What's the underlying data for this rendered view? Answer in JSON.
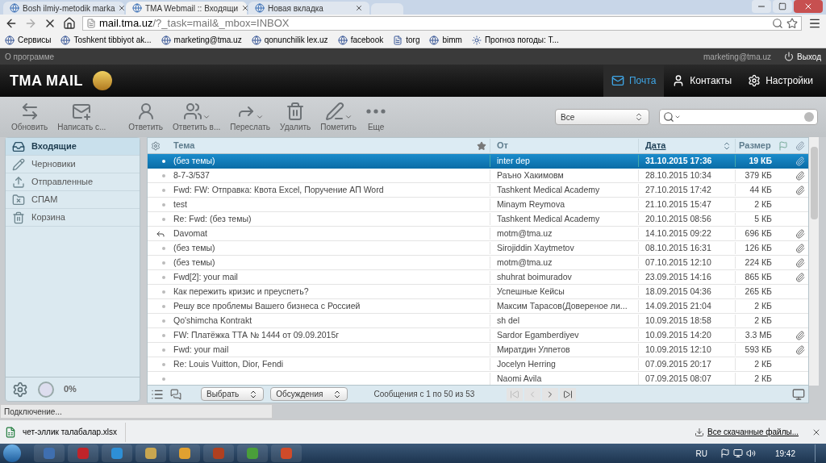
{
  "browser": {
    "tabs": [
      {
        "title": "Bosh ilmiy-metodik marka",
        "selected": false
      },
      {
        "title": "TMA Webmail :: Входящи",
        "selected": true
      },
      {
        "title": "Новая вкладка",
        "selected": false
      }
    ],
    "address": {
      "host": "mail.tma.uz",
      "path": "/?_task=mail&_mbox=INBOX"
    },
    "bookmarks": [
      "Сервисы",
      "Toshkent tibbiyot ak...",
      "marketing@tma.uz",
      "qonunchilik lex.uz",
      "facebook",
      "torg",
      "bimm",
      "Прогноз погоды: Т..."
    ]
  },
  "topbar": {
    "about": "О программе",
    "user": "marketing@tma.uz",
    "logout": "Выход"
  },
  "header": {
    "logo": "TMA MAIL",
    "nav": [
      {
        "label": "Почта",
        "selected": true
      },
      {
        "label": "Контакты",
        "selected": false
      },
      {
        "label": "Настройки",
        "selected": false
      }
    ]
  },
  "toolbar": {
    "buttons": [
      {
        "label": "Обновить",
        "dropdown": false
      },
      {
        "label": "Написать с...",
        "dropdown": false
      },
      {
        "label": "Ответить",
        "dropdown": false
      },
      {
        "label": "Ответить в...",
        "dropdown": true
      },
      {
        "label": "Переслать",
        "dropdown": true
      },
      {
        "label": "Удалить",
        "dropdown": false
      },
      {
        "label": "Пометить",
        "dropdown": true
      },
      {
        "label": "Еще",
        "dropdown": false
      }
    ],
    "filter": "Все"
  },
  "folders": [
    {
      "name": "Входящие",
      "selected": true
    },
    {
      "name": "Черновики",
      "selected": false
    },
    {
      "name": "Отправленные",
      "selected": false
    },
    {
      "name": "СПАМ",
      "selected": false
    },
    {
      "name": "Корзина",
      "selected": false
    }
  ],
  "quota": "0%",
  "table": {
    "columns": [
      "Тема",
      "От",
      "Дата",
      "Размер"
    ],
    "rows": [
      {
        "subject": "(без темы)",
        "from": "inter dep",
        "date": "31.10.2015 17:36",
        "size": "19 КБ",
        "attachment": true,
        "replied": false,
        "selected": true
      },
      {
        "subject": "8-7-3/537",
        "from": "Раъно Хакимовм",
        "date": "28.10.2015 10:34",
        "size": "379 КБ",
        "attachment": true,
        "replied": false,
        "selected": false
      },
      {
        "subject": "Fwd: FW: Отправка: Квота Excel, Поручение АП Word",
        "from": "Tashkent Medical Academy",
        "date": "27.10.2015 17:42",
        "size": "44 КБ",
        "attachment": true,
        "replied": false,
        "selected": false
      },
      {
        "subject": "test",
        "from": "Minaym Reymova",
        "date": "21.10.2015 15:47",
        "size": "2 КБ",
        "attachment": false,
        "replied": false,
        "selected": false
      },
      {
        "subject": "Re: Fwd: (без темы)",
        "from": "Tashkent Medical Academy",
        "date": "20.10.2015 08:56",
        "size": "5 КБ",
        "attachment": false,
        "replied": false,
        "selected": false
      },
      {
        "subject": "Davomat",
        "from": "motm@tma.uz",
        "date": "14.10.2015 09:22",
        "size": "696 КБ",
        "attachment": true,
        "replied": true,
        "selected": false
      },
      {
        "subject": "(без темы)",
        "from": "Sirojiddin Xaytmetov",
        "date": "08.10.2015 16:31",
        "size": "126 КБ",
        "attachment": true,
        "replied": false,
        "selected": false
      },
      {
        "subject": "(без темы)",
        "from": "motm@tma.uz",
        "date": "07.10.2015 12:10",
        "size": "224 КБ",
        "attachment": true,
        "replied": false,
        "selected": false
      },
      {
        "subject": "Fwd[2]: your mail",
        "from": "shuhrat boimuradov",
        "date": "23.09.2015 14:16",
        "size": "865 КБ",
        "attachment": true,
        "replied": false,
        "selected": false
      },
      {
        "subject": "Как пережить кризис и преуспеть?",
        "from": "Успешные Кейсы",
        "date": "18.09.2015 04:36",
        "size": "265 КБ",
        "attachment": false,
        "replied": false,
        "selected": false
      },
      {
        "subject": "Решу все проблемы Вашего бизнеса с Россией",
        "from": "Максим Тарасов(Довереное ли...",
        "date": "14.09.2015 21:04",
        "size": "2 КБ",
        "attachment": false,
        "replied": false,
        "selected": false
      },
      {
        "subject": "Qo'shimcha Kontrakt",
        "from": "sh del",
        "date": "10.09.2015 18:58",
        "size": "2 КБ",
        "attachment": false,
        "replied": false,
        "selected": false
      },
      {
        "subject": "FW: Платёжка ТТА № 1444 от 09.09.2015г",
        "from": "Sardor Egamberdiyev",
        "date": "10.09.2015 14:20",
        "size": "3.3 МБ",
        "attachment": true,
        "replied": false,
        "selected": false
      },
      {
        "subject": "Fwd: your mail",
        "from": "Миратдин Улпетов",
        "date": "10.09.2015 12:10",
        "size": "593 КБ",
        "attachment": true,
        "replied": false,
        "selected": false
      },
      {
        "subject": "Re: Louis Vuitton, Dior, Fendi",
        "from": "Jocelyn Herring",
        "date": "07.09.2015 20:17",
        "size": "2 КБ",
        "attachment": false,
        "replied": false,
        "selected": false
      },
      {
        "subject": "",
        "from": "Naomi Avila",
        "date": "07.09.2015 08:07",
        "size": "2 КБ",
        "attachment": false,
        "replied": false,
        "selected": false
      }
    ]
  },
  "footer": {
    "select": "Выбрать",
    "threads": "Обсуждения",
    "count": "Сообщения с 1 по 50 из 53"
  },
  "status": "Подключение...",
  "downloads": {
    "file": "чет-эллик талабалар.xlsx",
    "all": "Все скачанные файлы..."
  },
  "taskbar": {
    "lang": "RU",
    "time": "19:42"
  }
}
